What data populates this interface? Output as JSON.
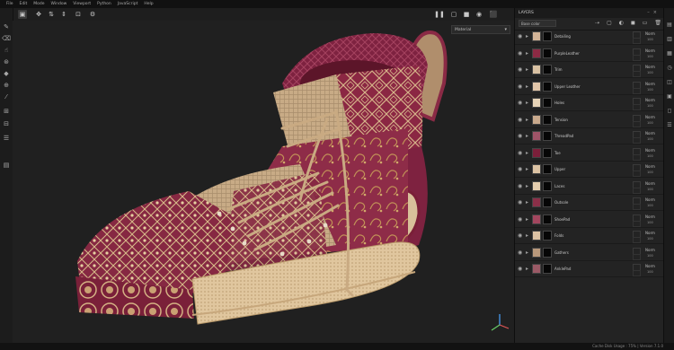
{
  "menu": [
    "File",
    "Edit",
    "Mode",
    "Window",
    "Viewport",
    "Python",
    "JavaScript",
    "Help"
  ],
  "toolbar": {
    "left_icons": [
      "select-icon",
      "move-icon",
      "rotate-icon",
      "scale-icon",
      "frame-icon",
      "settings-icon"
    ],
    "right_icons": [
      "pause-icon",
      "camera-icon",
      "render-icon",
      "sphere-icon",
      "screenshot-icon"
    ]
  },
  "left_tools": [
    "brush-icon",
    "eraser-icon",
    "smudge-icon",
    "clone-icon",
    "fill-icon",
    "picker-icon",
    "dropper-icon",
    "bake-icon",
    "projection-icon",
    "material-icon",
    "document-icon"
  ],
  "viewport": {
    "material_select": "Material"
  },
  "panel": {
    "title": "LAYERS",
    "blend_mode": "Base color",
    "tool_icons": [
      "new-layer-icon",
      "paint-icon",
      "fill-layer-icon",
      "mask-icon",
      "group-icon",
      "delete-icon"
    ],
    "layers": [
      {
        "name": "Detailing",
        "blend": "Norm",
        "opacity": "100",
        "thumb": "#d3b497"
      },
      {
        "name": "PurpleLeather",
        "blend": "Norm",
        "opacity": "100",
        "thumb": "#8d2a44"
      },
      {
        "name": "Trim",
        "blend": "Norm",
        "opacity": "100",
        "thumb": "#d9c1a2"
      },
      {
        "name": "Upper Leather",
        "blend": "Norm",
        "opacity": "100",
        "thumb": "#e2c6a9"
      },
      {
        "name": "Holes",
        "blend": "Norm",
        "opacity": "100",
        "thumb": "#e7d4b8"
      },
      {
        "name": "Tension",
        "blend": "Norm",
        "opacity": "100",
        "thumb": "#c9a98c"
      },
      {
        "name": "ThreadPad",
        "blend": "Norm",
        "opacity": "100",
        "thumb": "#a05468"
      },
      {
        "name": "Toe",
        "blend": "Norm",
        "opacity": "100",
        "thumb": "#7c1f3a"
      },
      {
        "name": "Upper",
        "blend": "Norm",
        "opacity": "100",
        "thumb": "#dcc3a3"
      },
      {
        "name": "Laces",
        "blend": "Norm",
        "opacity": "100",
        "thumb": "#e4cdad"
      },
      {
        "name": "Outsole",
        "blend": "Norm",
        "opacity": "100",
        "thumb": "#8b2f48"
      },
      {
        "name": "ShoePad",
        "blend": "Norm",
        "opacity": "100",
        "thumb": "#a3465e"
      },
      {
        "name": "Folds",
        "blend": "Norm",
        "opacity": "100",
        "thumb": "#dcc2a4"
      },
      {
        "name": "Gathers",
        "blend": "Norm",
        "opacity": "100",
        "thumb": "#b8987b"
      },
      {
        "name": "AnklePad",
        "blend": "Norm",
        "opacity": "100",
        "thumb": "#9b5a66"
      }
    ]
  },
  "right_strip": [
    "layers-icon",
    "properties-icon",
    "shelf-icon",
    "history-icon",
    "display-icon",
    "texture-icon",
    "viewer-icon",
    "log-icon"
  ],
  "status": "Cache Disk Usage : 75% | Version 7.1.0",
  "colors": {
    "bg": "#202020",
    "panel": "#232323",
    "maroon": "#8a2a45",
    "tan": "#d3b794"
  }
}
